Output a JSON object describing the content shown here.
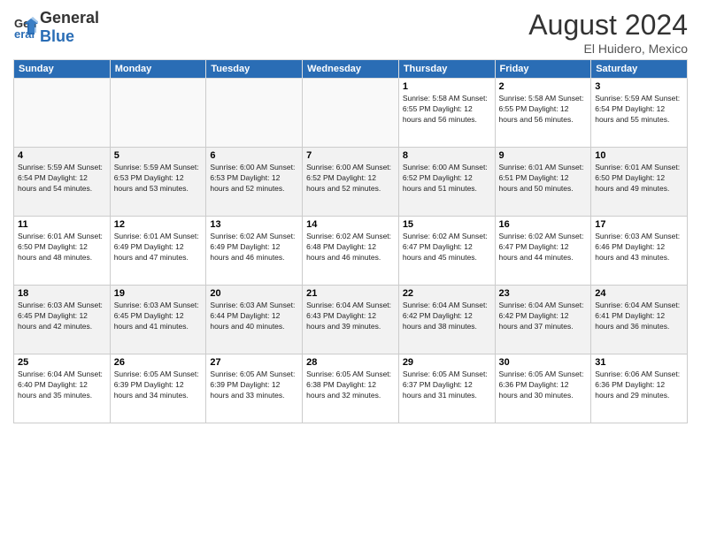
{
  "header": {
    "logo_general": "General",
    "logo_blue": "Blue",
    "month": "August 2024",
    "location": "El Huidero, Mexico"
  },
  "weekdays": [
    "Sunday",
    "Monday",
    "Tuesday",
    "Wednesday",
    "Thursday",
    "Friday",
    "Saturday"
  ],
  "weeks": [
    [
      {
        "day": "",
        "info": ""
      },
      {
        "day": "",
        "info": ""
      },
      {
        "day": "",
        "info": ""
      },
      {
        "day": "",
        "info": ""
      },
      {
        "day": "1",
        "info": "Sunrise: 5:58 AM\nSunset: 6:55 PM\nDaylight: 12 hours\nand 56 minutes."
      },
      {
        "day": "2",
        "info": "Sunrise: 5:58 AM\nSunset: 6:55 PM\nDaylight: 12 hours\nand 56 minutes."
      },
      {
        "day": "3",
        "info": "Sunrise: 5:59 AM\nSunset: 6:54 PM\nDaylight: 12 hours\nand 55 minutes."
      }
    ],
    [
      {
        "day": "4",
        "info": "Sunrise: 5:59 AM\nSunset: 6:54 PM\nDaylight: 12 hours\nand 54 minutes."
      },
      {
        "day": "5",
        "info": "Sunrise: 5:59 AM\nSunset: 6:53 PM\nDaylight: 12 hours\nand 53 minutes."
      },
      {
        "day": "6",
        "info": "Sunrise: 6:00 AM\nSunset: 6:53 PM\nDaylight: 12 hours\nand 52 minutes."
      },
      {
        "day": "7",
        "info": "Sunrise: 6:00 AM\nSunset: 6:52 PM\nDaylight: 12 hours\nand 52 minutes."
      },
      {
        "day": "8",
        "info": "Sunrise: 6:00 AM\nSunset: 6:52 PM\nDaylight: 12 hours\nand 51 minutes."
      },
      {
        "day": "9",
        "info": "Sunrise: 6:01 AM\nSunset: 6:51 PM\nDaylight: 12 hours\nand 50 minutes."
      },
      {
        "day": "10",
        "info": "Sunrise: 6:01 AM\nSunset: 6:50 PM\nDaylight: 12 hours\nand 49 minutes."
      }
    ],
    [
      {
        "day": "11",
        "info": "Sunrise: 6:01 AM\nSunset: 6:50 PM\nDaylight: 12 hours\nand 48 minutes."
      },
      {
        "day": "12",
        "info": "Sunrise: 6:01 AM\nSunset: 6:49 PM\nDaylight: 12 hours\nand 47 minutes."
      },
      {
        "day": "13",
        "info": "Sunrise: 6:02 AM\nSunset: 6:49 PM\nDaylight: 12 hours\nand 46 minutes."
      },
      {
        "day": "14",
        "info": "Sunrise: 6:02 AM\nSunset: 6:48 PM\nDaylight: 12 hours\nand 46 minutes."
      },
      {
        "day": "15",
        "info": "Sunrise: 6:02 AM\nSunset: 6:47 PM\nDaylight: 12 hours\nand 45 minutes."
      },
      {
        "day": "16",
        "info": "Sunrise: 6:02 AM\nSunset: 6:47 PM\nDaylight: 12 hours\nand 44 minutes."
      },
      {
        "day": "17",
        "info": "Sunrise: 6:03 AM\nSunset: 6:46 PM\nDaylight: 12 hours\nand 43 minutes."
      }
    ],
    [
      {
        "day": "18",
        "info": "Sunrise: 6:03 AM\nSunset: 6:45 PM\nDaylight: 12 hours\nand 42 minutes."
      },
      {
        "day": "19",
        "info": "Sunrise: 6:03 AM\nSunset: 6:45 PM\nDaylight: 12 hours\nand 41 minutes."
      },
      {
        "day": "20",
        "info": "Sunrise: 6:03 AM\nSunset: 6:44 PM\nDaylight: 12 hours\nand 40 minutes."
      },
      {
        "day": "21",
        "info": "Sunrise: 6:04 AM\nSunset: 6:43 PM\nDaylight: 12 hours\nand 39 minutes."
      },
      {
        "day": "22",
        "info": "Sunrise: 6:04 AM\nSunset: 6:42 PM\nDaylight: 12 hours\nand 38 minutes."
      },
      {
        "day": "23",
        "info": "Sunrise: 6:04 AM\nSunset: 6:42 PM\nDaylight: 12 hours\nand 37 minutes."
      },
      {
        "day": "24",
        "info": "Sunrise: 6:04 AM\nSunset: 6:41 PM\nDaylight: 12 hours\nand 36 minutes."
      }
    ],
    [
      {
        "day": "25",
        "info": "Sunrise: 6:04 AM\nSunset: 6:40 PM\nDaylight: 12 hours\nand 35 minutes."
      },
      {
        "day": "26",
        "info": "Sunrise: 6:05 AM\nSunset: 6:39 PM\nDaylight: 12 hours\nand 34 minutes."
      },
      {
        "day": "27",
        "info": "Sunrise: 6:05 AM\nSunset: 6:39 PM\nDaylight: 12 hours\nand 33 minutes."
      },
      {
        "day": "28",
        "info": "Sunrise: 6:05 AM\nSunset: 6:38 PM\nDaylight: 12 hours\nand 32 minutes."
      },
      {
        "day": "29",
        "info": "Sunrise: 6:05 AM\nSunset: 6:37 PM\nDaylight: 12 hours\nand 31 minutes."
      },
      {
        "day": "30",
        "info": "Sunrise: 6:05 AM\nSunset: 6:36 PM\nDaylight: 12 hours\nand 30 minutes."
      },
      {
        "day": "31",
        "info": "Sunrise: 6:06 AM\nSunset: 6:36 PM\nDaylight: 12 hours\nand 29 minutes."
      }
    ]
  ]
}
